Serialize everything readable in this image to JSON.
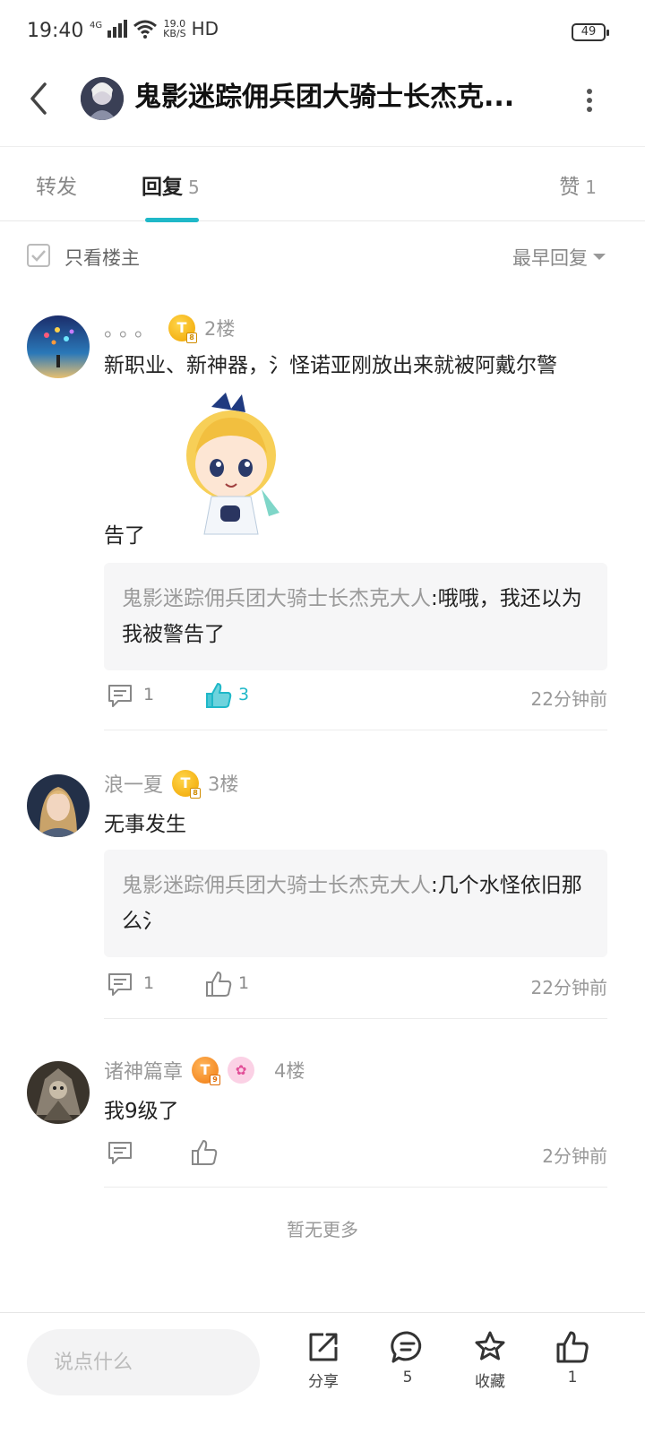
{
  "status": {
    "time": "19:40",
    "net": "4G",
    "speed_top": "19.0",
    "speed_bottom": "KB/S",
    "hd": "HD",
    "battery": "49"
  },
  "header": {
    "title": "鬼影迷踪佣兵团大骑士长杰克..."
  },
  "tabs": [
    {
      "label": "转发",
      "count": ""
    },
    {
      "label": "回复",
      "count": "5"
    },
    {
      "label": "赞",
      "count": "1"
    }
  ],
  "filter": {
    "label": "只看楼主",
    "sort": "最早回复"
  },
  "replies": [
    {
      "name": "。。。",
      "badge": "T",
      "floor": "2楼",
      "text": "新职业、新神器，氵怪诺亚刚放出来就被阿戴尔警",
      "text2": "告了",
      "quote_name": "鬼影迷踪佣兵团大骑士长杰克大人",
      "quote_text": ":哦哦，我还以为我被警告了",
      "comments": "1",
      "likes": "3",
      "time": "22分钟前"
    },
    {
      "name": "浪一夏",
      "badge": "T",
      "floor": "3楼",
      "text": "无事发生",
      "quote_name": "鬼影迷踪佣兵团大骑士长杰克大人",
      "quote_text": ":几个水怪依旧那么氵",
      "comments": "1",
      "likes": "1",
      "time": "22分钟前"
    },
    {
      "name": "诸神篇章",
      "badge": "T",
      "badge2": "✿",
      "floor": "4楼",
      "text": "我9级了",
      "time": "2分钟前"
    }
  ],
  "no_more": "暂无更多",
  "bottom": {
    "placeholder": "说点什么",
    "share": "分享",
    "comments": "5",
    "favorite": "收藏",
    "likes": "1"
  },
  "colors": {
    "accent": "#1fb8c8",
    "badge_gold": "#f0a400"
  }
}
